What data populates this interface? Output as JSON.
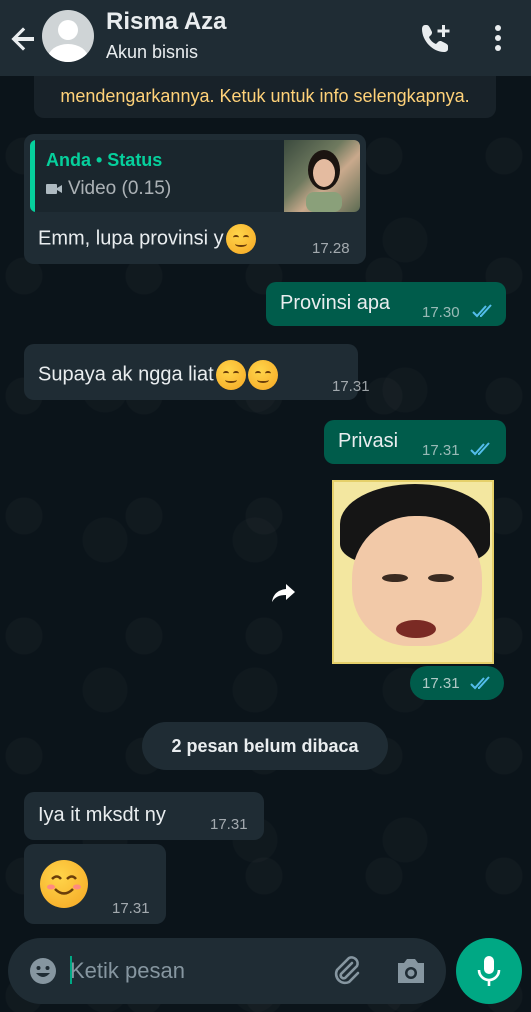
{
  "header": {
    "contact_name": "Risma Aza",
    "contact_subtitle": "Akun bisnis"
  },
  "notice": {
    "text": "mendengarkannya. Ketuk untuk info selengkapnya."
  },
  "messages": [
    {
      "direction": "in",
      "quote": {
        "author": "Anda • Status",
        "media": "Video (0.15)"
      },
      "text": "Emm, lupa provinsi y",
      "time": "17.28"
    },
    {
      "direction": "out",
      "text": "Provinsi apa",
      "time": "17.30",
      "status": "read"
    },
    {
      "direction": "in",
      "text": "Supaya ak ngga liat",
      "time": "17.31"
    },
    {
      "direction": "out",
      "text": "Privasi",
      "time": "17.31",
      "status": "read"
    },
    {
      "direction": "out",
      "type": "sticker",
      "time": "17.31",
      "status": "read"
    },
    {
      "direction": "in",
      "text": "Iya it mksdt ny",
      "time": "17.31"
    },
    {
      "direction": "in",
      "type": "emoji",
      "time": "17.31"
    }
  ],
  "unread_banner": "2 pesan belum dibaca",
  "composer": {
    "placeholder": "Ketik pesan"
  },
  "colors": {
    "background": "#0b141a",
    "header": "#1f2c34",
    "incoming_bubble": "#1f2c34",
    "outgoing_bubble": "#005c4b",
    "accent": "#00a884",
    "read_ticks": "#53bdeb",
    "notice_text": "#ffd279"
  },
  "icons": [
    "back-arrow-icon",
    "avatar",
    "add-call-icon",
    "more-vert-icon",
    "video-icon",
    "read-ticks-icon",
    "forward-icon",
    "emoji-icon",
    "attach-icon",
    "camera-icon",
    "mic-icon"
  ]
}
